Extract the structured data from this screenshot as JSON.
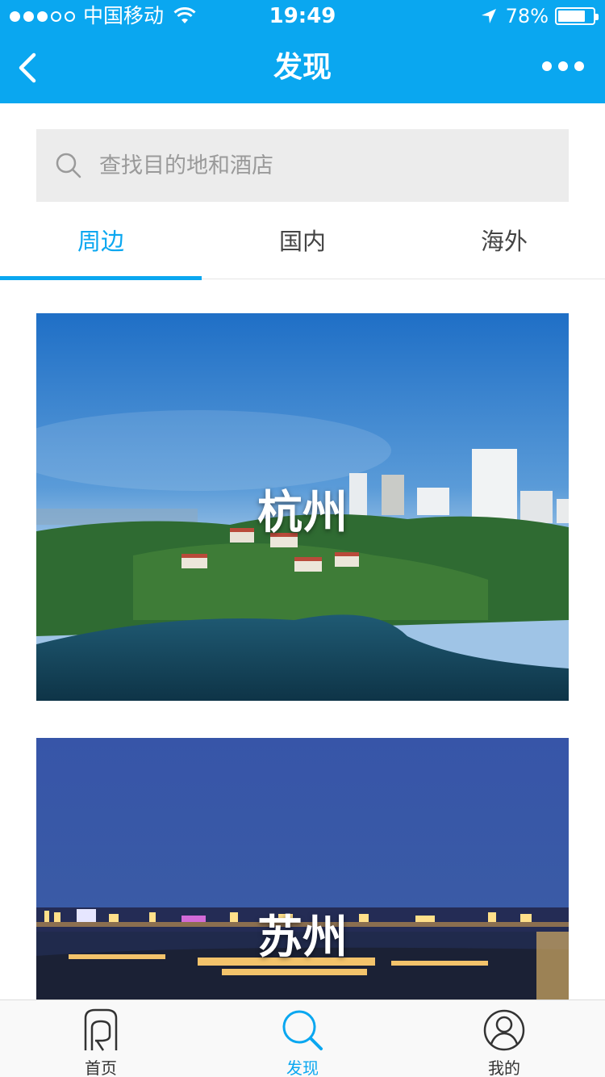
{
  "status_bar": {
    "carrier": "中国移动",
    "time": "19:49",
    "battery": "78%",
    "battery_level": 0.78,
    "signal_dots": [
      true,
      true,
      true,
      false,
      false
    ]
  },
  "nav": {
    "title": "发现",
    "back_icon": "chevron-left-icon",
    "more_icon": "more-icon"
  },
  "search": {
    "placeholder": "查找目的地和酒店",
    "value": ""
  },
  "tabs": [
    {
      "label": "周边",
      "active": true
    },
    {
      "label": "国内",
      "active": false
    },
    {
      "label": "海外",
      "active": false
    }
  ],
  "cards": [
    {
      "title": "杭州"
    },
    {
      "title": "苏州"
    }
  ],
  "tabbar": [
    {
      "label": "首页",
      "icon": "home-icon",
      "active": false
    },
    {
      "label": "发现",
      "icon": "search-icon",
      "active": true
    },
    {
      "label": "我的",
      "icon": "user-icon",
      "active": false
    }
  ],
  "colors": {
    "accent": "#0aa7f0",
    "search_bg": "#ececec"
  }
}
